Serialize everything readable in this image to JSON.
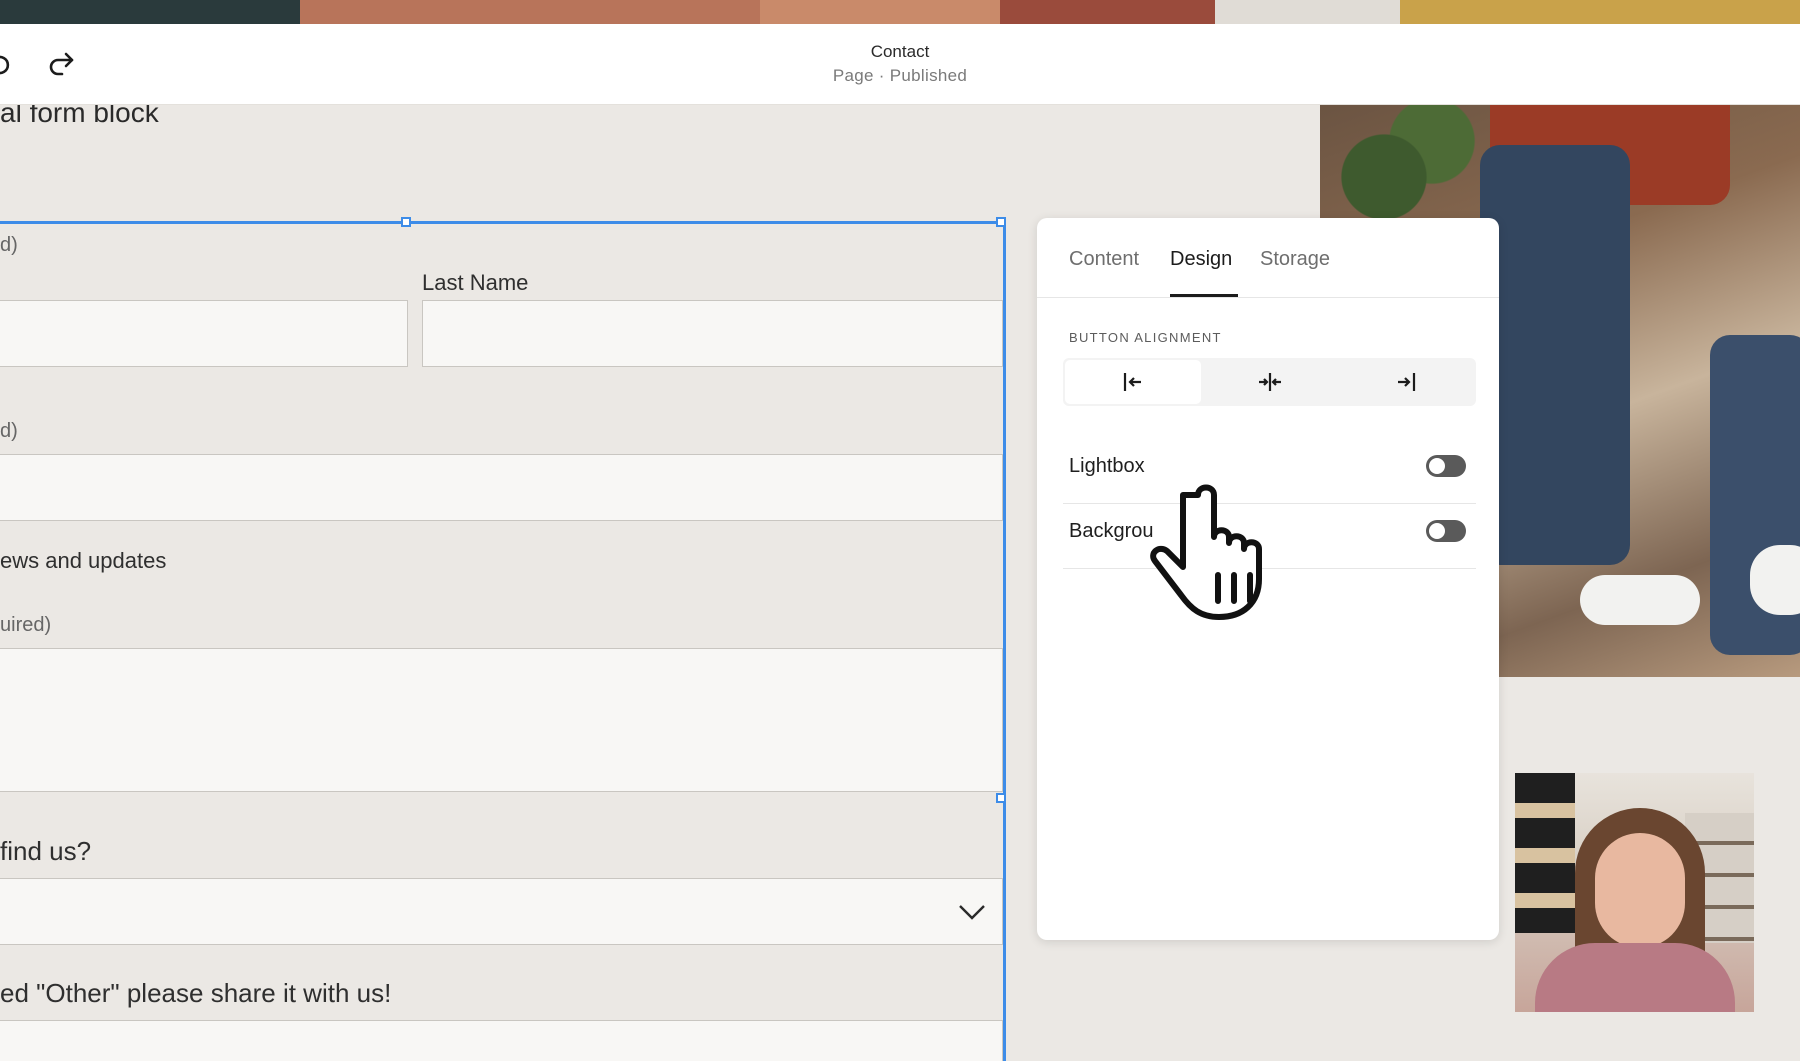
{
  "toolbar": {
    "title": "Contact",
    "subtitle": "Page · Published"
  },
  "canvas": {
    "block_title": "al form block",
    "fields": {
      "first_note": "d)",
      "last_name_label": "Last Name",
      "email_note": "d)",
      "newsletter_label": "ews and updates",
      "message_note": "uired)",
      "find_us_label": "find us?",
      "other_label": "ed \"Other\" please share it with us!"
    }
  },
  "panel": {
    "tabs": [
      {
        "label": "Content",
        "active": false
      },
      {
        "label": "Design",
        "active": true
      },
      {
        "label": "Storage",
        "active": false
      }
    ],
    "section_title": "BUTTON ALIGNMENT",
    "alignment": {
      "options": [
        "align-left-icon",
        "align-center-icon",
        "align-right-icon"
      ],
      "selected": "align-left-icon"
    },
    "rows": [
      {
        "label": "Lightbox",
        "enabled": false
      },
      {
        "label": "Backgrou",
        "enabled": false
      }
    ]
  }
}
